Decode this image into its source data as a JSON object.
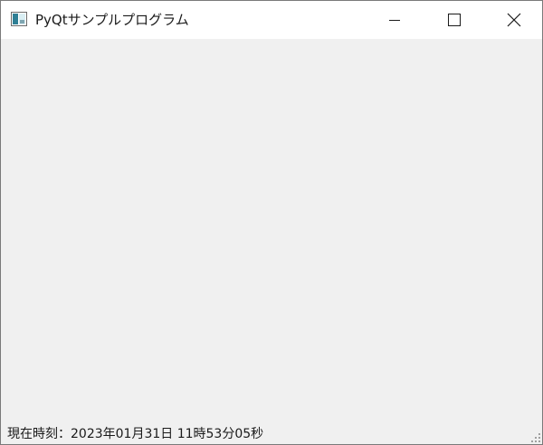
{
  "window": {
    "title": "PyQtサンプルプログラム",
    "icons": {
      "app": "app-window-icon",
      "minimize": "minimize-icon",
      "maximize": "maximize-icon",
      "close": "close-icon",
      "size_grip": "size-grip-icon"
    }
  },
  "statusbar": {
    "text": "現在時刻：2023年01月31日 11時53分05秒"
  },
  "colors": {
    "titlebar_bg": "#ffffff",
    "client_bg": "#f0f0f0",
    "border": "#7a7a7a",
    "text": "#1a1a1a"
  }
}
